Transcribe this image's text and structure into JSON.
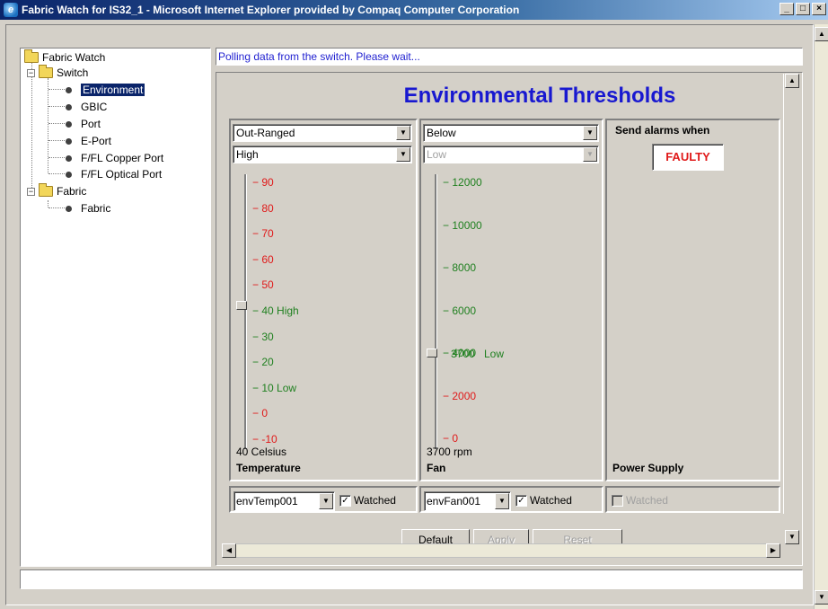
{
  "window": {
    "title": "Fabric Watch for IS32_1 - Microsoft Internet Explorer provided by Compaq Computer Corporation",
    "minimize": "_",
    "maximize": "□",
    "close": "×"
  },
  "tree": {
    "root": "Fabric Watch",
    "switch": "Switch",
    "switch_items": [
      "Environment",
      "GBIC",
      "Port",
      "E-Port",
      "F/FL Copper Port",
      "F/FL Optical Port"
    ],
    "fabric": "Fabric",
    "fabric_items": [
      "Fabric"
    ],
    "selected": "Environment"
  },
  "status_message": "Polling data from the switch.  Please wait...",
  "panel": {
    "heading": "Environmental Thresholds",
    "temperature": {
      "condition_select": "Out-Ranged",
      "boundary_select": "High",
      "scale": [
        "90",
        "80",
        "70",
        "60",
        "50",
        "40",
        "30",
        "20",
        "10",
        "0",
        "-10"
      ],
      "scale_colors": [
        "red",
        "red",
        "red",
        "red",
        "red",
        "green",
        "green",
        "green",
        "green",
        "red",
        "red"
      ],
      "high_label": "High",
      "low_label": "Low",
      "thumb_value": 40,
      "readout": "40 Celsius",
      "title": "Temperature",
      "combo": "envTemp001",
      "watched": "Watched"
    },
    "fan": {
      "condition_select": "Below",
      "boundary_select": "Low",
      "scale": [
        "12000",
        "10000",
        "8000",
        "6000",
        "4000",
        "2000",
        "0"
      ],
      "scale_colors": [
        "green",
        "green",
        "green",
        "green",
        "green",
        "red",
        "red"
      ],
      "overlap_value": "3700",
      "low_label": "Low",
      "thumb_value": 3700,
      "readout": "3700 rpm",
      "title": "Fan",
      "combo": "envFan001",
      "watched": "Watched"
    },
    "power": {
      "send_alarms_label": "Send alarms when",
      "state": "FAULTY",
      "title": "Power Supply",
      "watched": "Watched"
    },
    "buttons": {
      "default": "Default",
      "apply": "Apply",
      "reset": "Reset"
    }
  },
  "colors": {
    "heading": "#1818d0",
    "status_text": "#1f1fd0",
    "alarm": "#e01a1a",
    "ok": "#208020",
    "selection": "#0a246a"
  }
}
